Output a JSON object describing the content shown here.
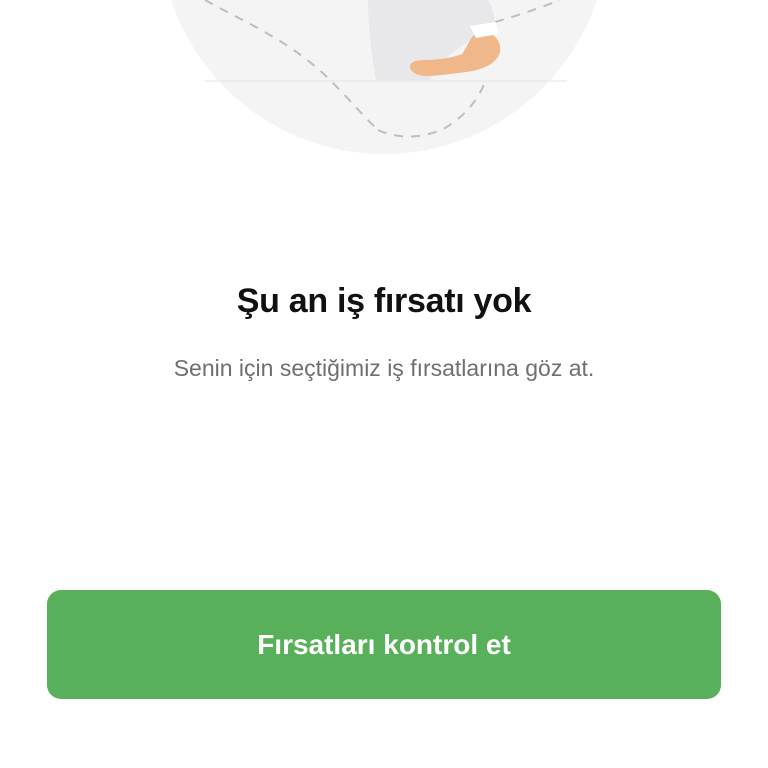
{
  "empty_state": {
    "title": "Şu an iş fırsatı yok",
    "subtitle": "Senin için seçtiğimiz iş fırsatlarına göz at.",
    "illustration_icon": "person-illustration-icon"
  },
  "actions": {
    "check_opportunities_label": "Fırsatları kontrol et"
  },
  "colors": {
    "primary": "#58b05a",
    "title": "#111111",
    "subtitle": "#6e6e73",
    "illustration_bg": "#f4f4f5"
  }
}
